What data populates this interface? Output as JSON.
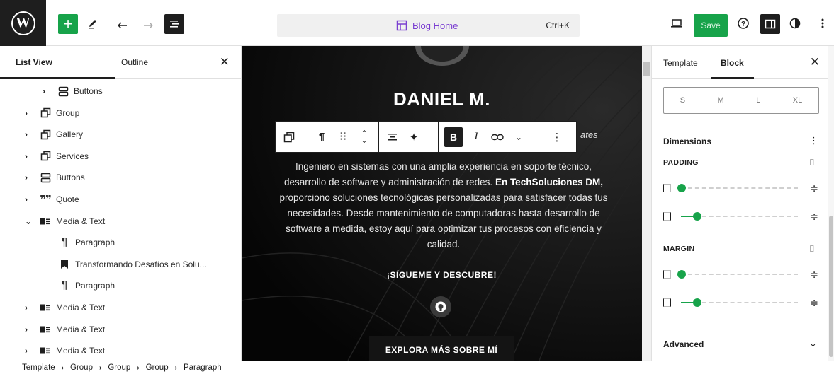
{
  "header": {
    "document_title": "Blog Home",
    "shortcut": "Ctrl+K",
    "save_label": "Save"
  },
  "left_panel": {
    "tabs": [
      "List View",
      "Outline"
    ],
    "items": [
      {
        "label": "Buttons",
        "icon": "buttons-icon",
        "chevron": "›"
      },
      {
        "label": "Group",
        "icon": "group-icon",
        "chevron": "›"
      },
      {
        "label": "Gallery",
        "icon": "group-icon",
        "chevron": "›"
      },
      {
        "label": "Services",
        "icon": "group-icon",
        "chevron": "›"
      },
      {
        "label": "Buttons",
        "icon": "buttons-icon",
        "chevron": "›"
      },
      {
        "label": "Quote",
        "icon": "quote-icon",
        "chevron": "›"
      },
      {
        "label": "Media & Text",
        "icon": "media-text-icon",
        "chevron": "⌄"
      },
      {
        "label": "Paragraph",
        "icon": "paragraph-icon",
        "chevron": ""
      },
      {
        "label": "Transformando Desafíos en Solu...",
        "icon": "bookmark-icon",
        "chevron": ""
      },
      {
        "label": "Paragraph",
        "icon": "paragraph-icon",
        "chevron": ""
      },
      {
        "label": "Media & Text",
        "icon": "media-text-icon",
        "chevron": "›"
      },
      {
        "label": "Media & Text",
        "icon": "media-text-icon",
        "chevron": "›"
      },
      {
        "label": "Media & Text",
        "icon": "media-text-icon",
        "chevron": "›"
      }
    ]
  },
  "canvas": {
    "name": "DANIEL M.",
    "subtitle_fragment": "ates",
    "text_before_bold": "Ingeniero en sistemas con una amplia experiencia en soporte técnico, desarrollo de software y administración de redes. ",
    "text_bold": "En TechSoluciones DM,",
    "text_after_bold": " proporciono soluciones tecnológicas personalizadas para satisfacer todas tus necesidades. Desde mantenimiento de computadoras hasta desarrollo de software a medida, estoy aquí para optimizar tus procesos con eficiencia y calidad.",
    "follow_label": "¡SÍGUEME Y DESCUBRE!",
    "explore_label": "EXPLORA MÁS SOBRE MÍ"
  },
  "right_panel": {
    "tabs": [
      "Template",
      "Block"
    ],
    "size_options": [
      "S",
      "M",
      "L",
      "XL"
    ],
    "dimensions_title": "Dimensions",
    "padding_label": "PADDING",
    "margin_label": "MARGIN",
    "advanced_label": "Advanced",
    "sliders": {
      "padding_vertical": 0.0,
      "padding_horizontal": 0.3,
      "margin_vertical": 0.0,
      "margin_horizontal": 0.3
    }
  },
  "breadcrumb": [
    "Template",
    "Group",
    "Group",
    "Group",
    "Paragraph"
  ],
  "colors": {
    "accent": "#17a34a",
    "doc_title": "#7b3fd1",
    "dark": "#1e1e1e"
  }
}
